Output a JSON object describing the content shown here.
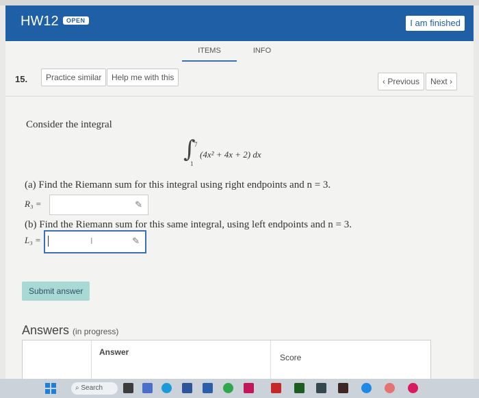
{
  "header": {
    "title": "HW12",
    "badge": "OPEN",
    "finished_label": "I am finished"
  },
  "tabs": [
    "ITEMS",
    "INFO"
  ],
  "question": {
    "number": "15.",
    "practice_label": "Practice similar",
    "help_label": "Help me with this",
    "prev_label": "Previous",
    "next_label": "Next",
    "prompt": "Consider the integral",
    "integral": {
      "lower": "1",
      "upper": "7",
      "integrand": "(4x² + 4x + 2) dx"
    },
    "part_a": "(a) Find the Riemann sum for this integral using right endpoints and n = 3.",
    "r_label": "R₃ =",
    "r_value": "",
    "part_b": "(b) Find the Riemann sum for this same integral, using left endpoints and n = 3.",
    "l_label": "L₃ =",
    "l_value": ""
  },
  "submit_label": "Submit answer",
  "answers": {
    "title": "Answers",
    "status": "(in progress)",
    "col_answer": "Answer",
    "col_score": "Score"
  },
  "taskbar": {
    "search_label": "Search"
  },
  "icons": [
    "pencil-icon",
    "chevron-left-icon",
    "chevron-right-icon",
    "windows-icon",
    "search-icon"
  ]
}
